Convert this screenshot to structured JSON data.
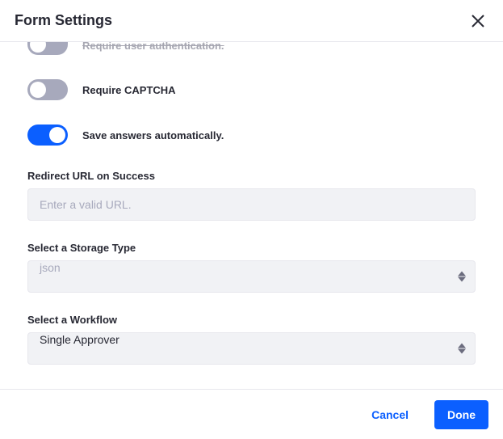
{
  "header": {
    "title": "Form Settings"
  },
  "toggles": {
    "auth": {
      "label": "Require user authentication.",
      "on": false,
      "partial": true
    },
    "captcha": {
      "label": "Require CAPTCHA",
      "on": false
    },
    "autosave": {
      "label": "Save answers automatically.",
      "on": true
    }
  },
  "redirect": {
    "label": "Redirect URL on Success",
    "placeholder": "Enter a valid URL.",
    "value": ""
  },
  "storage": {
    "label": "Select a Storage Type",
    "value": "json"
  },
  "workflow": {
    "label": "Select a Workflow",
    "value": "Single Approver"
  },
  "footer": {
    "cancel": "Cancel",
    "done": "Done"
  }
}
